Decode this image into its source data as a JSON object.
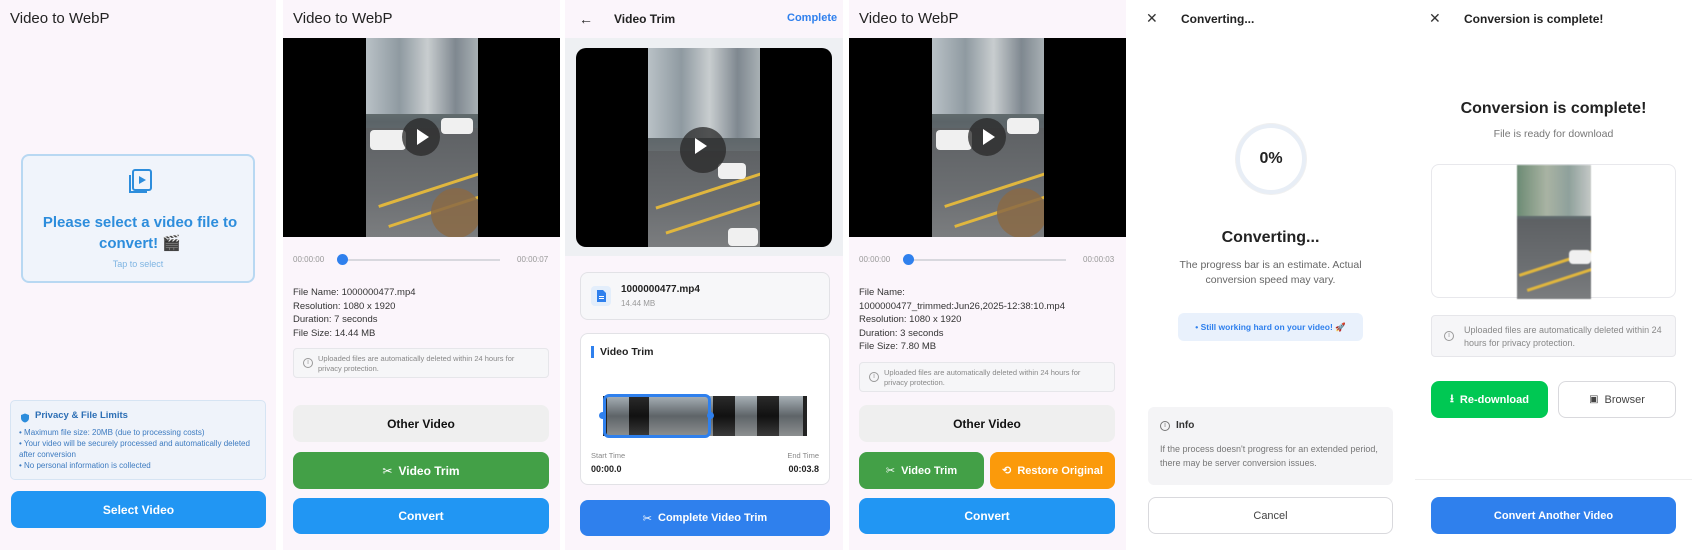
{
  "screen1": {
    "title": "Video to WebP",
    "select_prompt": "Please select a video file to convert! 🎬",
    "tap_hint": "Tap to select",
    "privacy_title": "Privacy & File Limits",
    "privacy_items": [
      "• Maximum file size: 20MB (due to processing costs)",
      "• Your video will be securely processed and automatically deleted after conversion",
      "• No personal information is collected"
    ],
    "select_button": "Select Video"
  },
  "screen2": {
    "title": "Video to WebP",
    "time_start": "00:00:00",
    "time_end": "00:00:07",
    "progress": 0,
    "file_name": "File Name: 1000000477.mp4",
    "resolution": "Resolution: 1080 x 1920",
    "duration": "Duration: 7 seconds",
    "file_size": "File Size: 14.44 MB",
    "notice": "Uploaded files are automatically deleted within 24 hours for privacy protection.",
    "other_video": "Other Video",
    "video_trim": "Video Trim",
    "convert": "Convert"
  },
  "screen3": {
    "back_icon": "arrow-left-icon",
    "title": "Video Trim",
    "complete": "Complete",
    "file_name": "1000000477.mp4",
    "file_size": "14.44 MB",
    "section_title": "Video Trim",
    "start_label": "Start Time",
    "start_value": "00:00.0",
    "end_label": "End Time",
    "end_value": "00:03.8",
    "complete_button": "Complete Video Trim"
  },
  "screen4": {
    "title": "Video to WebP",
    "time_start": "00:00:00",
    "time_end": "00:00:03",
    "progress": 0,
    "file_name_label": "File Name:",
    "file_name": "1000000477_trimmed:Jun26,2025-12:38:10.mp4",
    "resolution": "Resolution: 1080 x 1920",
    "duration": "Duration: 3 seconds",
    "file_size": "File Size: 7.80 MB",
    "notice": "Uploaded files are automatically deleted within 24 hours for privacy protection.",
    "other_video": "Other Video",
    "video_trim": "Video Trim",
    "restore": "Restore Original",
    "convert": "Convert"
  },
  "screen5": {
    "title": "Converting...",
    "percent": "0%",
    "heading": "Converting...",
    "estimate": "The progress bar is an estimate. Actual conversion speed may vary.",
    "working": "• Still working hard on your video! 🚀",
    "info_title": "Info",
    "info_text": "If the process doesn't progress for an extended period, there may be server conversion issues.",
    "cancel": "Cancel"
  },
  "screen6": {
    "title": "Conversion is complete!",
    "heading": "Conversion is complete!",
    "subheading": "File is ready for download",
    "notice": "Uploaded files are automatically deleted within 24 hours for privacy protection.",
    "redownload": "Re-download",
    "browser": "Browser",
    "convert_another": "Convert Another Video"
  },
  "colors": {
    "primary": "#2196f3",
    "green": "#43a047",
    "orange": "#fb9a0b",
    "download_green": "#00c853"
  }
}
